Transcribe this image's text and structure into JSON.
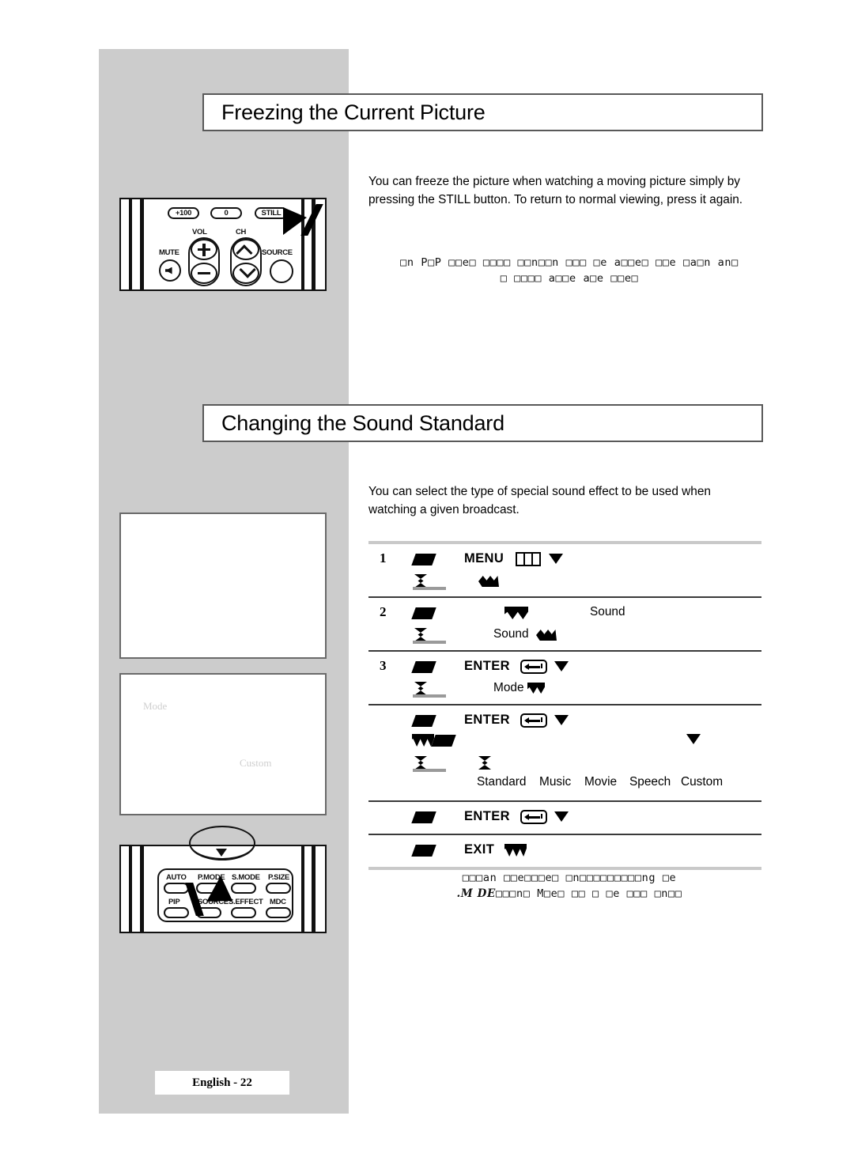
{
  "document": {
    "footer_label": "English -  22",
    "page_number": "22"
  },
  "sections": [
    {
      "heading": "Freezing the Current Picture",
      "body": "You can freeze the picture when watching a moving picture simply by pressing the  STILL  button. To return to normal viewing, press it again.",
      "note_line1": "□n P□P □□e□ □□□□ □□n□□n □□□ □e a□□e□ □□e □a□n an□",
      "note_line2": "□ □□□□ a□□e a□e □□e□"
    },
    {
      "heading": "Changing the Sound Standard",
      "body": "You can select the type of special sound effect to be used when watching a given broadcast.",
      "note_line1": "□□□an □□e□□□e□ □n□□□□□□□□□ng □e",
      "note_line2_italic": ".M  DE",
      "note_line2": "□□□n□ M□e□ □□ □ □e □□□ □n□□"
    }
  ],
  "steps": [
    {
      "number": "1",
      "keyword": "MENU",
      "icon": "menu-pane-icon",
      "sub_label": ""
    },
    {
      "number": "2",
      "keyword": "",
      "label_right": "Sound",
      "sub_label": "Sound"
    },
    {
      "number": "3",
      "keyword": "ENTER",
      "icon": "enter-key-icon",
      "sub_label": "Mode"
    },
    {
      "number": "",
      "keyword": "ENTER",
      "icon": "enter-key-icon",
      "options": [
        "Standard",
        "Music",
        "Movie",
        "Speech",
        "Custom"
      ]
    },
    {
      "number": "",
      "keyword": "ENTER",
      "icon": "enter-key-icon"
    },
    {
      "number": "",
      "keyword": "EXIT",
      "icon": "exit-icon"
    }
  ],
  "menu_screenshots": [
    {
      "caption": ""
    },
    {
      "faint_label_1": "Mode",
      "faint_label_2": "Custom"
    }
  ],
  "remote_top": {
    "buttons": [
      "+100",
      "0",
      "STILL",
      "MUTE",
      "SOURCE"
    ],
    "labels": [
      "VOL",
      "CH"
    ],
    "highlight": "STILL"
  },
  "remote_bottom": {
    "row1": [
      "AUTO",
      "P.MODE",
      "S.MODE",
      "P.SIZE"
    ],
    "row2": [
      "PIP",
      "SOURCE",
      "S.EFFECT",
      "MDC"
    ],
    "highlight": "S.MODE"
  },
  "colors": {
    "panel_grey": "#cccccc",
    "rule_grey": "#c9c9c9",
    "rule_dark": "#3a3a3a",
    "border_grey": "#595959",
    "faint_text": "#cfcfcf"
  }
}
